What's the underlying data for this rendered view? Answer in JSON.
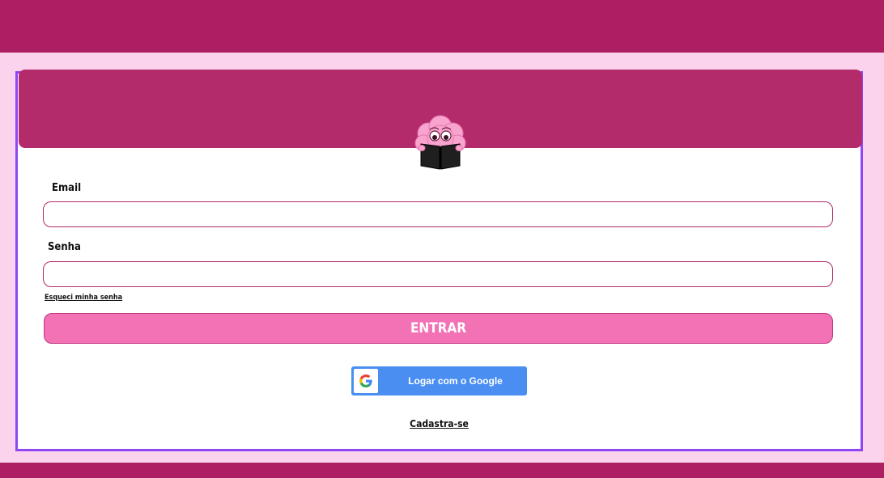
{
  "colors": {
    "bar": "#ad1f62",
    "background": "#fbd3ec",
    "header": "#b32b6b",
    "card_border": "#9146f5",
    "enter_button": "#f272b5",
    "google_button": "#4a8ef2"
  },
  "login": {
    "email_label": "Email",
    "email_value": "",
    "password_label": "Senha",
    "password_value": "",
    "forgot_password": "Esqueci minha senha",
    "enter_button": "ENTRAR",
    "google_button": "Logar com o Google",
    "signup_link": "Cadastra-se"
  },
  "icons": {
    "mascot": "brain-reading-book-icon",
    "google": "google-logo-icon"
  }
}
